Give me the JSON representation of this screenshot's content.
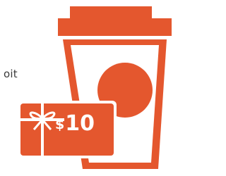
{
  "page": {
    "partial_text": "oit"
  },
  "gift_card": {
    "currency_symbol": "$",
    "amount": "10"
  },
  "colors": {
    "accent": "#e4572e",
    "background": "#ffffff",
    "text": "#3a3a3a"
  },
  "icons": {
    "cup": "coffee-cup-icon",
    "card": "gift-card-icon",
    "bow": "gift-bow-icon"
  }
}
